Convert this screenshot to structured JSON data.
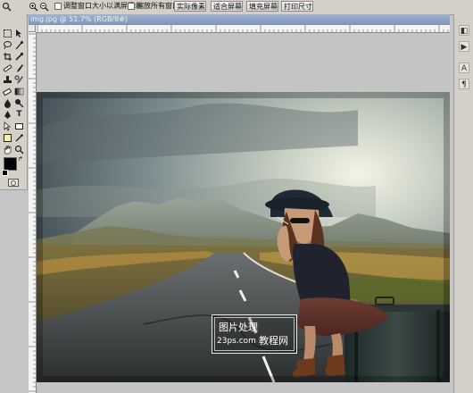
{
  "options_bar": {
    "resize_windows_label": "调整窗口大小以满屏显示",
    "zoom_all_label": "缩放所有窗口",
    "actual_pixels": "实际像素",
    "fit_screen": "适合屏幕",
    "fill_screen": "填充屏幕",
    "print_size": "打印尺寸"
  },
  "document": {
    "title": "img.jpg @ 51.7% (RGB/8#)",
    "watermark_line1": "图片处理",
    "watermark_line2": "23ps.com",
    "watermark_line3": "教程网"
  },
  "colors": {
    "foreground": "#000000",
    "background": "#ffffff",
    "panel": "#d4d0c8",
    "titlebar": "#8aa0bf"
  }
}
